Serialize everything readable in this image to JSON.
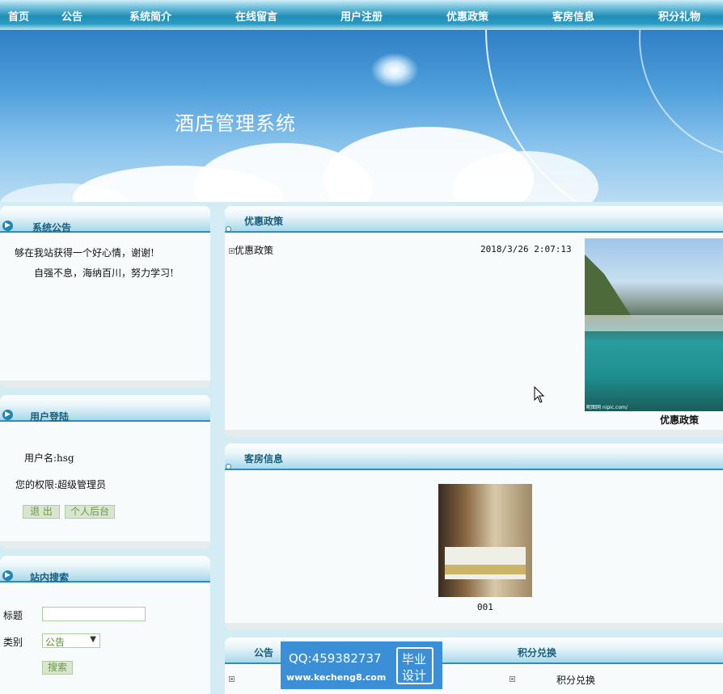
{
  "nav": {
    "items": [
      "首页",
      "公告",
      "系统简介",
      "在线留言",
      "用户注册",
      "优惠政策",
      "客房信息",
      "积分礼物"
    ]
  },
  "banner": {
    "title": "酒店管理系统"
  },
  "sidebar": {
    "notice": {
      "title": "系统公告",
      "lines": [
        "够在我站获得一个好心情，谢谢!",
        "自强不息，海纳百川，努力学习!"
      ]
    },
    "login": {
      "title": "用户登陆",
      "username_line": "用户名:hsg",
      "role_line": "您的权限:超级管理员",
      "logout_label": "退 出",
      "backend_label": "个人后台"
    },
    "search": {
      "title": "站内搜索",
      "title_label": "标题",
      "title_value": "",
      "category_label": "类别",
      "category_value": "公告",
      "search_label": "搜索"
    }
  },
  "policy": {
    "title": "优惠政策",
    "item_label": "优惠政策",
    "item_time": "2018/3/26 2:07:13",
    "image_caption": "优惠政策",
    "image_mark": "昵图网 nipic.com/"
  },
  "rooms": {
    "title": "客房信息",
    "room_name": "001"
  },
  "bottom": {
    "notice_title": "公告",
    "points_title": "积分兑换",
    "points_item": "积分兑换"
  },
  "watermark": {
    "qq": "QQ:459382737",
    "site": "www.kecheng8.com",
    "tag1": "毕业",
    "tag2": "设计"
  },
  "colors": {
    "nav": "#1f8fb8",
    "panel_title": "#1a5e7d",
    "button_text": "#6b9a3f"
  }
}
